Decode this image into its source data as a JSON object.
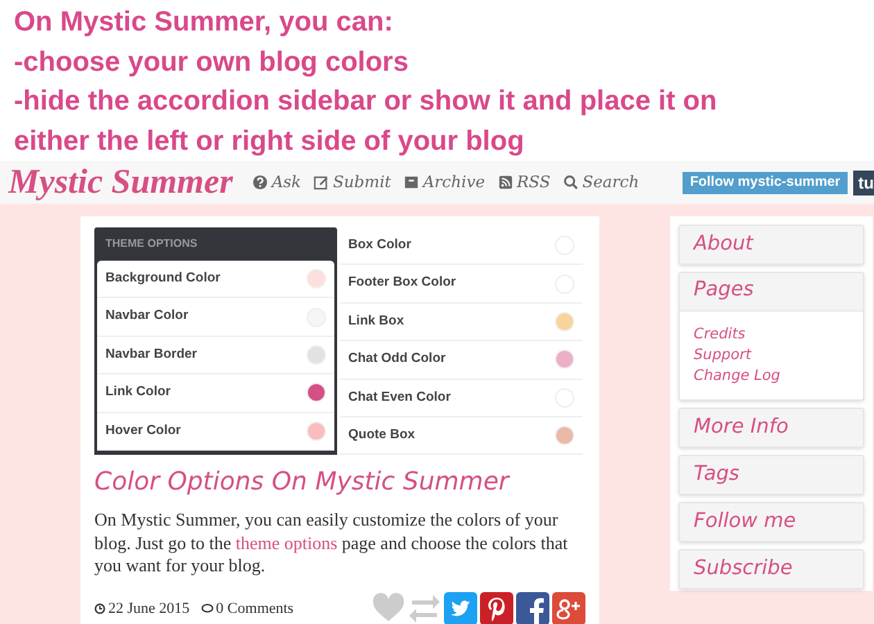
{
  "caption": [
    "On Mystic Summer, you can:",
    "-choose your own blog colors",
    "-hide the accordion sidebar or show it and place it on",
    "either the left or right side of your blog"
  ],
  "navbar": {
    "logo": "Mystic Summer",
    "links": [
      {
        "kind": "question",
        "label": "Ask"
      },
      {
        "kind": "edit",
        "label": "Submit"
      },
      {
        "kind": "archive",
        "label": "Archive"
      },
      {
        "kind": "rss",
        "label": "RSS"
      },
      {
        "kind": "search",
        "label": "Search"
      }
    ],
    "follow_button": "Follow mystic-summer",
    "tumblr_button": "tu"
  },
  "theme_options": {
    "header": "THEME OPTIONS",
    "left": [
      {
        "label": "Background Color",
        "color": "#fde0de"
      },
      {
        "label": "Navbar Color",
        "color": "#f5f5f5"
      },
      {
        "label": "Navbar Border",
        "color": "#e2e2e2"
      },
      {
        "label": "Link Color",
        "color": "#d64f85"
      },
      {
        "label": "Hover Color",
        "color": "#fbbcbc"
      }
    ],
    "right": [
      {
        "label": "Box Color",
        "color": "#ffffff"
      },
      {
        "label": "Footer Box Color",
        "color": "#ffffff"
      },
      {
        "label": "Link Box",
        "color": "#f8d49c"
      },
      {
        "label": "Chat Odd Color",
        "color": "#ecafc6"
      },
      {
        "label": "Chat Even Color",
        "color": "#ffffff"
      },
      {
        "label": "Quote Box",
        "color": "#ebb9a8"
      }
    ]
  },
  "post": {
    "title": "Color Options On Mystic Summer",
    "body_before": "On Mystic Summer, you can easily customize the colors of your blog. Just go to the ",
    "link": "theme options",
    "body_after": " page and choose the colors that you want for your blog.",
    "date": "22 June 2015",
    "comments": "0 Comments",
    "actions": [
      {
        "kind": "like"
      },
      {
        "kind": "reblog"
      },
      {
        "kind": "twitter"
      },
      {
        "kind": "pinterest"
      },
      {
        "kind": "facebook"
      },
      {
        "kind": "googleplus"
      }
    ]
  },
  "sidebar": [
    {
      "title": "About",
      "expanded": false
    },
    {
      "title": "Pages",
      "expanded": true,
      "children": [
        "Credits",
        "Support",
        "Change Log"
      ]
    },
    {
      "title": "More Info",
      "expanded": false
    },
    {
      "title": "Tags",
      "expanded": false
    },
    {
      "title": "Follow me",
      "expanded": false
    },
    {
      "title": "Subscribe",
      "expanded": false
    }
  ]
}
